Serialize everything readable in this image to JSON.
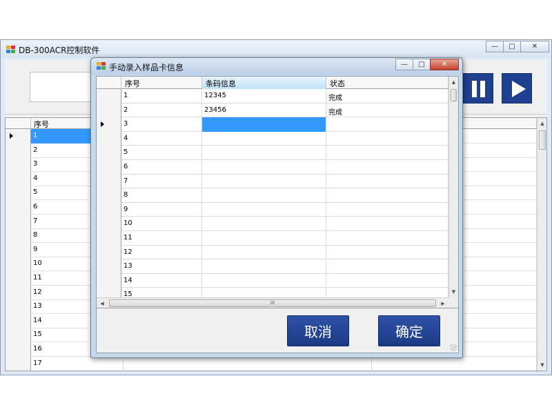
{
  "main_window": {
    "title": "DB-300ACR控制软件",
    "grid": {
      "header": "序号",
      "rows": [
        "1",
        "2",
        "3",
        "4",
        "5",
        "6",
        "7",
        "8",
        "9",
        "10",
        "11",
        "12",
        "13",
        "14",
        "15",
        "16",
        "17"
      ],
      "selected_row": 0
    }
  },
  "dialog": {
    "title": "手动录入样品卡信息",
    "grid": {
      "headers": [
        "序号",
        "条码信息",
        "状态"
      ],
      "rows": [
        {
          "seq": "1",
          "barcode": "12345",
          "status": "完成"
        },
        {
          "seq": "2",
          "barcode": "23456",
          "status": "完成"
        },
        {
          "seq": "3",
          "barcode": "",
          "status": ""
        },
        {
          "seq": "4",
          "barcode": "",
          "status": ""
        },
        {
          "seq": "5",
          "barcode": "",
          "status": ""
        },
        {
          "seq": "6",
          "barcode": "",
          "status": ""
        },
        {
          "seq": "7",
          "barcode": "",
          "status": ""
        },
        {
          "seq": "8",
          "barcode": "",
          "status": ""
        },
        {
          "seq": "9",
          "barcode": "",
          "status": ""
        },
        {
          "seq": "10",
          "barcode": "",
          "status": ""
        },
        {
          "seq": "11",
          "barcode": "",
          "status": ""
        },
        {
          "seq": "12",
          "barcode": "",
          "status": ""
        },
        {
          "seq": "13",
          "barcode": "",
          "status": ""
        },
        {
          "seq": "14",
          "barcode": "",
          "status": ""
        },
        {
          "seq": "15",
          "barcode": "",
          "status": ""
        }
      ],
      "current_row": 2,
      "hscroll_grip": "III"
    },
    "cancel_label": "取消",
    "ok_label": "确定"
  }
}
